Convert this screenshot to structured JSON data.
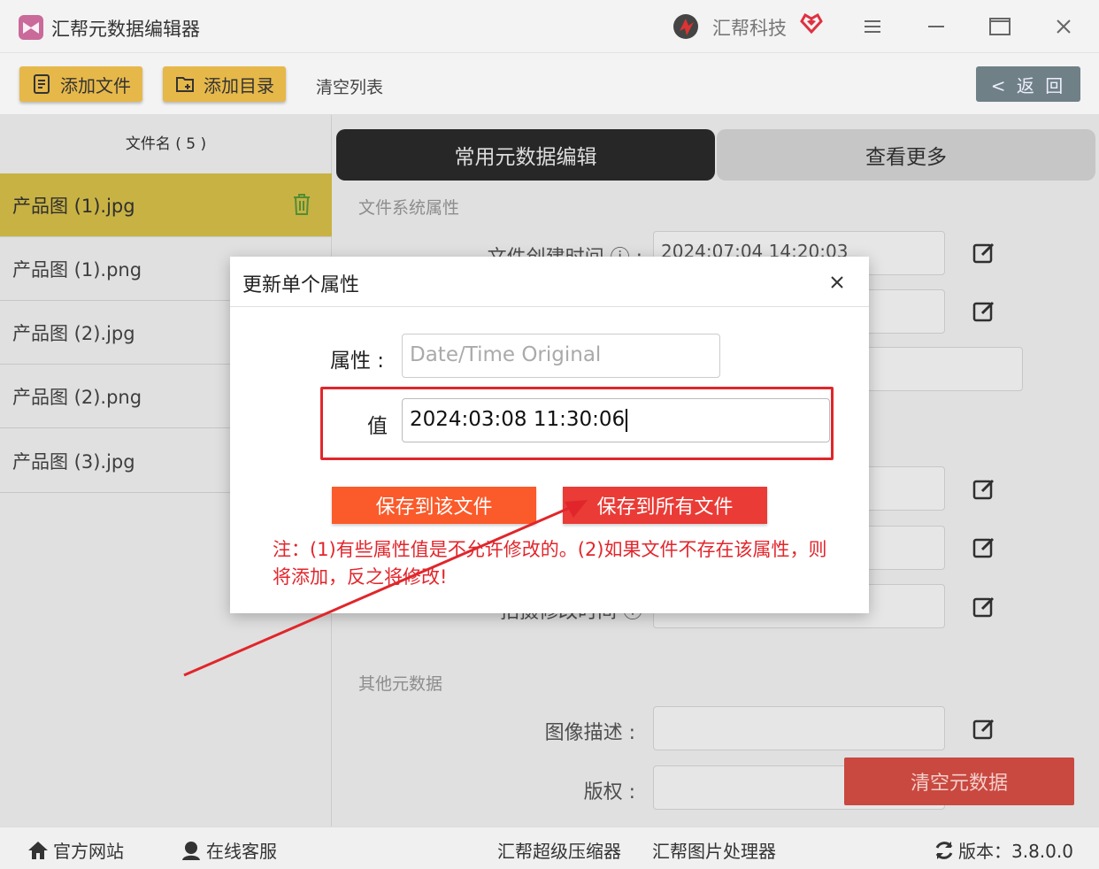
{
  "app": {
    "title": "汇帮元数据编辑器",
    "brand": "汇帮科技",
    "icons": [
      "app-logo-icon",
      "brand-logo-icon",
      "heart-icon",
      "menu-icon",
      "minimize-icon",
      "maximize-icon",
      "close-icon"
    ]
  },
  "toolbar": {
    "add_file": "添加文件",
    "add_folder": "添加目录",
    "clear_list": "清空列表",
    "back": "< 返 回"
  },
  "sidebar": {
    "header": "文件名 ( 5 )",
    "files": [
      {
        "name": "产品图 (1).jpg",
        "selected": true
      },
      {
        "name": "产品图 (1).png",
        "selected": false
      },
      {
        "name": "产品图 (2).jpg",
        "selected": false
      },
      {
        "name": "产品图 (2).png",
        "selected": false
      },
      {
        "name": "产品图 (3).jpg",
        "selected": false
      }
    ]
  },
  "main": {
    "tabs": [
      {
        "label": "常用元数据编辑",
        "active": true
      },
      {
        "label": "查看更多",
        "active": false
      }
    ],
    "section_fs": "文件系统属性",
    "created_label": "文件创建时间 ⓘ :",
    "created_value": "2024:07:04 14:20:03",
    "shot_label": "拍摄修改时间 ⓘ",
    "section_other": "其他元数据",
    "desc_label": "图像描述 :",
    "copyright_label": "版权 :",
    "clear_metadata": "清空元数据"
  },
  "dialog": {
    "title": "更新单个属性",
    "attr_label": "属性 :",
    "attr_placeholder": "Date/Time Original",
    "value_label": "值",
    "value": "2024:03:08 11:30:06",
    "save_one": "保存到该文件",
    "save_all": "保存到所有文件",
    "note": "注：(1)有些属性值是不允许修改的。(2)如果文件不存在该属性，则将添加，反之将修改!"
  },
  "statusbar": {
    "website": "官方网站",
    "support": "在线客服",
    "compressor": "汇帮超级压缩器",
    "image_tool": "汇帮图片处理器",
    "version": "版本：3.8.0.0"
  },
  "colors": {
    "toolbar_button": "#e6b84a",
    "selected_row": "#d9c24a",
    "active_tab": "#2b2b2b",
    "save_one": "#fb5a2a",
    "save_all": "#ea3b36",
    "annotation_red": "#e0262b",
    "clear_metadata": "#c9483f"
  }
}
